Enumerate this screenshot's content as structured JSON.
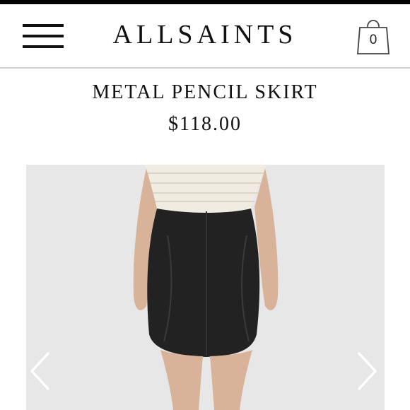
{
  "header": {
    "brand": "ALLSAINTS",
    "menu_icon": "hamburger-menu-icon",
    "cart_icon": "shopping-bag-icon",
    "cart_count": "0"
  },
  "product": {
    "title": "METAL PENCIL SKIRT",
    "price": "$118.00"
  },
  "carousel": {
    "prev_icon": "chevron-left-icon",
    "next_icon": "chevron-right-icon",
    "background_color": "#e7e7e7"
  },
  "colors": {
    "status_bar": "#000000",
    "text": "#111111",
    "divider": "#cfcfcf"
  }
}
